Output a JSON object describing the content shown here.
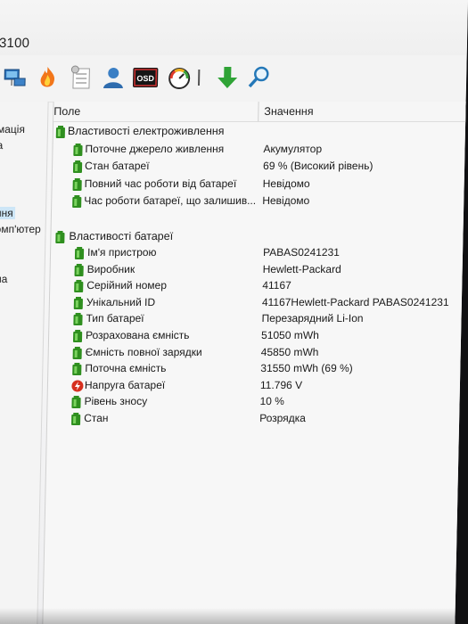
{
  "window": {
    "title": "3100"
  },
  "toolbar": {
    "items": [
      {
        "icon": "network-icon"
      },
      {
        "icon": "fire-icon"
      },
      {
        "icon": "checklist-icon"
      },
      {
        "icon": "user-icon"
      },
      {
        "icon": "osd-icon",
        "label": "OSD"
      },
      {
        "icon": "gauge-icon"
      },
      {
        "icon": "separator-icon"
      },
      {
        "icon": "download-arrow-icon"
      },
      {
        "icon": "search-icon"
      }
    ]
  },
  "left_pane": {
    "items": [
      {
        "label": "мація"
      },
      {
        "label": "а"
      },
      {
        "label": "ння",
        "selected": true
      },
      {
        "label": "омп'ютер"
      },
      {
        "label": "ма"
      },
      {
        "label": "х"
      }
    ]
  },
  "table": {
    "header_field": "Поле",
    "header_value": "Значення",
    "section1": {
      "title": "Властивості електроживлення",
      "rows": [
        {
          "field": "Поточне джерело живлення",
          "value": "Акумулятор"
        },
        {
          "field": "Стан батареї",
          "value": "69 % (Високий рівень)"
        },
        {
          "field": "Повний час роботи від батареї",
          "value": "Невідомо"
        },
        {
          "field": "Час роботи батареї, що залишив...",
          "value": "Невідомо"
        }
      ]
    },
    "section2": {
      "title": "Властивості батареї",
      "rows": [
        {
          "field": "Ім'я пристрою",
          "value": "PABAS0241231"
        },
        {
          "field": "Виробник",
          "value": "Hewlett-Packard"
        },
        {
          "field": "Серійний номер",
          "value": "41167"
        },
        {
          "field": "Унікальний ID",
          "value": "41167Hewlett-Packard PABAS0241231"
        },
        {
          "field": "Тип батареї",
          "value": "Перезарядний Li-Ion"
        },
        {
          "field": "Розрахована ємність",
          "value": "51050 mWh"
        },
        {
          "field": "Ємність повної зарядки",
          "value": "45850 mWh"
        },
        {
          "field": "Поточна ємність",
          "value": "31550 mWh  (69 %)"
        },
        {
          "field": "Напруга батареї",
          "value": "11.796 V"
        },
        {
          "field": "Рівень зносу",
          "value": "10 %"
        },
        {
          "field": "Стан",
          "value": "Розрядка"
        }
      ]
    }
  },
  "colors": {
    "battery_green": "#2f8f1f",
    "selection_blue": "#cde6f7",
    "voltage_red": "#d6301f"
  }
}
